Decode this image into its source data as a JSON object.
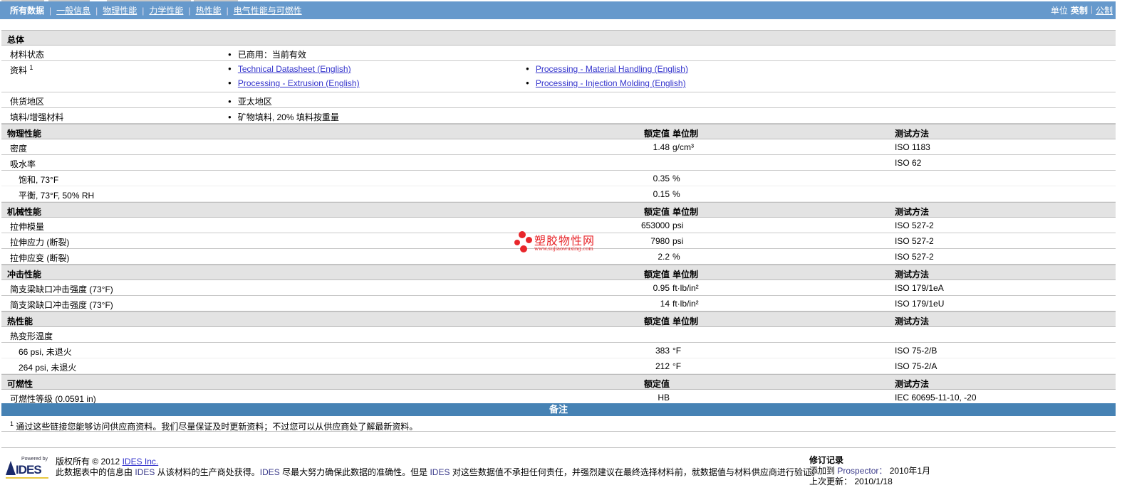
{
  "nav": {
    "tabs": [
      "所有数据",
      "一般信息",
      "物理性能",
      "力学性能",
      "热性能",
      "电气性能与可燃性"
    ],
    "units_label": "单位",
    "unit_active": "英制",
    "unit_other": "公制"
  },
  "rows": [
    {
      "type": "hdr",
      "label": "总体"
    },
    {
      "type": "bullet",
      "label": "材料状态",
      "items": [
        "已商用：当前有效"
      ]
    },
    {
      "type": "links",
      "label": "资料",
      "sup": "1",
      "links": [
        "Technical Datasheet (English)",
        "Processing - Material Handling (English)",
        "Processing - Extrusion (English)",
        "Processing - Injection Molding (English)"
      ]
    },
    {
      "type": "bullet",
      "label": "供货地区",
      "items": [
        "亚太地区"
      ]
    },
    {
      "type": "bullet",
      "label": "填料/增强材料",
      "items": [
        "矿物填料, 20% 填料按重量"
      ]
    },
    {
      "type": "hdr",
      "label": "物理性能",
      "val": "额定值",
      "unit": "单位制",
      "test": "测试方法"
    },
    {
      "type": "data",
      "label": "密度",
      "val": "1.48",
      "unit": "g/cm³",
      "test": "ISO 1183"
    },
    {
      "type": "data",
      "label": "吸水率",
      "val": "",
      "unit": "",
      "test": "ISO 62"
    },
    {
      "type": "ind",
      "label": "饱和, 73°F",
      "val": "0.35",
      "unit": "%",
      "test": ""
    },
    {
      "type": "ind",
      "label": "平衡, 73°F, 50% RH",
      "val": "0.15",
      "unit": "%",
      "test": ""
    },
    {
      "type": "hdr",
      "label": "机械性能",
      "val": "额定值",
      "unit": "单位制",
      "test": "测试方法"
    },
    {
      "type": "data",
      "label": "拉伸模量",
      "val": "653000",
      "unit": "psi",
      "test": "ISO 527-2"
    },
    {
      "type": "data",
      "label": "拉伸应力 (断裂)",
      "val": "7980",
      "unit": "psi",
      "test": "ISO 527-2"
    },
    {
      "type": "data",
      "label": "拉伸应变 (断裂)",
      "val": "2.2",
      "unit": "%",
      "test": "ISO 527-2"
    },
    {
      "type": "hdr",
      "label": "冲击性能",
      "val": "额定值",
      "unit": "单位制",
      "test": "测试方法"
    },
    {
      "type": "data",
      "label": "简支梁缺口冲击强度 (73°F)",
      "val": "0.95",
      "unit": "ft·lb/in²",
      "test": "ISO 179/1eA"
    },
    {
      "type": "data",
      "label": "简支梁缺口冲击强度 (73°F)",
      "val": "14",
      "unit": "ft·lb/in²",
      "test": "ISO 179/1eU"
    },
    {
      "type": "hdr",
      "label": "热性能",
      "val": "额定值",
      "unit": "单位制",
      "test": "测试方法"
    },
    {
      "type": "data",
      "label": "热变形温度",
      "val": "",
      "unit": "",
      "test": ""
    },
    {
      "type": "ind",
      "label": "66 psi, 未退火",
      "val": "383",
      "unit": "°F",
      "test": "ISO 75-2/B"
    },
    {
      "type": "ind",
      "label": "264 psi, 未退火",
      "val": "212",
      "unit": "°F",
      "test": "ISO 75-2/A"
    },
    {
      "type": "hdr",
      "label": "可燃性",
      "val": "额定值",
      "unit": "",
      "test": "测试方法"
    },
    {
      "type": "data",
      "label": "可燃性等级 (0.0591 in)",
      "val": "HB",
      "unit": "",
      "test": "IEC 60695-11-10, -20"
    }
  ],
  "notes": {
    "title": "备注",
    "sup": "1",
    "text": "通过这些链接您能够访问供应商资料。我们尽量保证及时更新资料；不过您可以从供应商处了解最新资料。"
  },
  "watermark": {
    "title": "塑胶物性网",
    "url": "www.sujiaowuxing.com"
  },
  "footer": {
    "logo_powered": "Powered by",
    "logo_name": "IDES",
    "copyright": "版权所有 © 2012",
    "company_link": "IDES Inc.",
    "disclaimer_1": "此数据表中的信息由",
    "ides1": "IDES",
    "disclaimer_2": "从该材料的生产商处获得。",
    "ides2": "IDES",
    "disclaimer_3": "尽最大努力确保此数据的准确性。但是",
    "ides3": "IDES",
    "disclaimer_4": "对这些数据值不承担任何责任，并强烈建议在最终选择材料前，就数据值与材料供应商进行验证。",
    "revision_title": "修订记录",
    "added_label": "添加到",
    "added_where": "Prospector：",
    "added_date": "2010年1月",
    "updated_label": "上次更新：",
    "updated_date": "2010/1/18"
  }
}
